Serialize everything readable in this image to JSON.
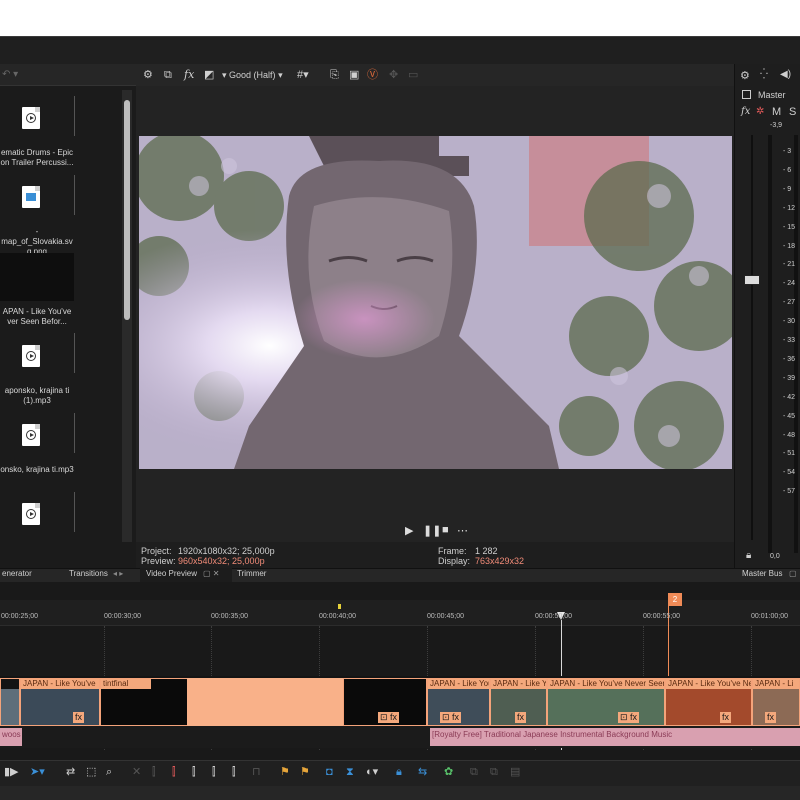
{
  "media": {
    "items": [
      {
        "label1": "ematic Drums - Epic",
        "label2": "on Trailer Percussi...",
        "icon": "audio-file-icon"
      },
      {
        "label1": "-map_of_Slovakia.sv",
        "label2": "g.png",
        "icon": "image-file-icon"
      },
      {
        "label1": "APAN - Like You've",
        "label2": "ver Seen Befor...",
        "icon": "video-thumb"
      },
      {
        "label1": "aponsko, krajina ti",
        "label2": "(1).mp3",
        "icon": "audio-file-icon"
      },
      {
        "label1": "onsko, krajina ti.mp3",
        "label2": "",
        "icon": "audio-file-icon"
      },
      {
        "label1": "",
        "label2": "",
        "icon": "audio-file-icon"
      }
    ]
  },
  "preview": {
    "quality": "Good (Half)",
    "project_label": "Project:",
    "project_value": "1920x1080x32; 25,000p",
    "preview_label": "Preview:",
    "preview_value": "960x540x32; 25,000p",
    "frame_label": "Frame:",
    "frame_value": "1 282",
    "display_label": "Display:",
    "display_value": "763x429x32"
  },
  "master": {
    "title": "Master",
    "m": "M",
    "s": "S",
    "fx": "fx",
    "peak": "-3,9",
    "scale": [
      "3",
      "6",
      "9",
      "12",
      "15",
      "18",
      "21",
      "24",
      "27",
      "30",
      "33",
      "36",
      "39",
      "42",
      "45",
      "48",
      "51",
      "54",
      "57"
    ],
    "bottom_value": "0,0"
  },
  "tabs": {
    "generator": "enerator",
    "transitions": "Transitions",
    "video_preview": "Video Preview",
    "trimmer": "Trimmer",
    "master_bus": "Master Bus"
  },
  "timeline": {
    "marker": "2",
    "ruler": [
      "00:00:25;00",
      "00:00:30;00",
      "00:00:35;00",
      "00:00:40;00",
      "00:00:45;00",
      "00:00:50;00",
      "00:00:55;00",
      "00:01:00;00"
    ],
    "clips": [
      "JAPAN - Like You've",
      "JAPAN - Like You've",
      "tintfinal",
      "JAPAN - Like You",
      "JAPAN - Like You'",
      "JAPAN - Like You've Never Seen",
      "JAPAN - Like You've Ne",
      "JAPAN - Li"
    ],
    "audio": [
      "woos",
      "[Royalty Free] Traditional Japanese Instrumental Background Music"
    ]
  },
  "colors": {
    "accent": "#f4a87c",
    "audio_clip": "#d9a0b0",
    "info_highlight": "#f08b78"
  }
}
